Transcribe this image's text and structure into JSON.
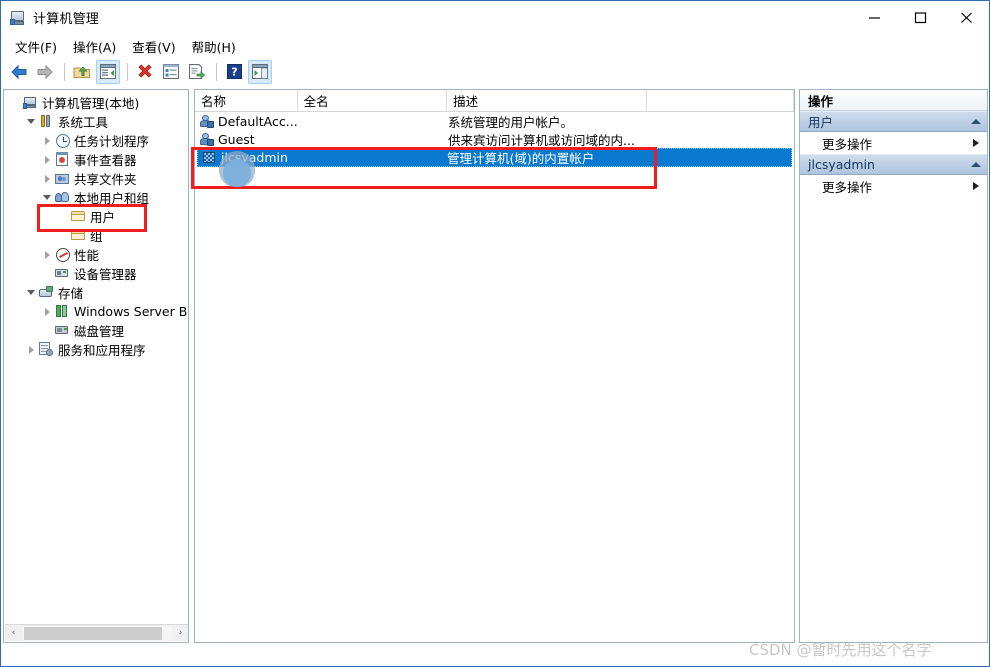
{
  "window": {
    "title": "计算机管理",
    "icon": "computer-management-icon",
    "minimize_label": "—",
    "maximize_label": "□",
    "close_label": "✕"
  },
  "menubar": {
    "items": [
      {
        "label": "文件(F)",
        "name": "menu-file"
      },
      {
        "label": "操作(A)",
        "name": "menu-action"
      },
      {
        "label": "查看(V)",
        "name": "menu-view"
      },
      {
        "label": "帮助(H)",
        "name": "menu-help"
      }
    ]
  },
  "toolbar": {
    "buttons": [
      {
        "name": "back-icon",
        "active": false
      },
      {
        "name": "forward-icon",
        "active": false
      },
      {
        "name": "up-folder-icon",
        "active": false
      },
      {
        "name": "show-hide-tree-icon",
        "active": true
      },
      {
        "name": "delete-icon",
        "active": false
      },
      {
        "name": "properties-icon",
        "active": false
      },
      {
        "name": "export-list-icon",
        "active": false
      },
      {
        "name": "help-icon",
        "active": false
      },
      {
        "name": "show-action-pane-icon",
        "active": true
      }
    ]
  },
  "tree": {
    "items": [
      {
        "label": "计算机管理(本地)",
        "indent": 0,
        "toggle": "none",
        "icon": "computer-icon",
        "name": "tree-item-computer-management"
      },
      {
        "label": "系统工具",
        "indent": 1,
        "toggle": "down",
        "icon": "tools-icon",
        "name": "tree-item-system-tools"
      },
      {
        "label": "任务计划程序",
        "indent": 2,
        "toggle": "right",
        "icon": "clock-icon",
        "name": "tree-item-task-scheduler"
      },
      {
        "label": "事件查看器",
        "indent": 2,
        "toggle": "right",
        "icon": "event-viewer-icon",
        "name": "tree-item-event-viewer"
      },
      {
        "label": "共享文件夹",
        "indent": 2,
        "toggle": "right",
        "icon": "shared-folders-icon",
        "name": "tree-item-shared-folders"
      },
      {
        "label": "本地用户和组",
        "indent": 2,
        "toggle": "down",
        "icon": "local-users-icon",
        "name": "tree-item-local-users-and-groups"
      },
      {
        "label": "用户",
        "indent": 3,
        "toggle": "none",
        "icon": "folder-icon",
        "name": "tree-item-users"
      },
      {
        "label": "组",
        "indent": 3,
        "toggle": "none",
        "icon": "folder-icon",
        "name": "tree-item-groups"
      },
      {
        "label": "性能",
        "indent": 2,
        "toggle": "right",
        "icon": "performance-icon",
        "name": "tree-item-performance"
      },
      {
        "label": "设备管理器",
        "indent": 2,
        "toggle": "none",
        "icon": "device-manager-icon",
        "name": "tree-item-device-manager"
      },
      {
        "label": "存储",
        "indent": 1,
        "toggle": "down",
        "icon": "storage-icon",
        "name": "tree-item-storage"
      },
      {
        "label": "Windows Server Back",
        "indent": 2,
        "toggle": "right",
        "icon": "backup-icon",
        "name": "tree-item-windows-server-backup"
      },
      {
        "label": "磁盘管理",
        "indent": 2,
        "toggle": "none",
        "icon": "disk-management-icon",
        "name": "tree-item-disk-management"
      },
      {
        "label": "服务和应用程序",
        "indent": 1,
        "toggle": "right",
        "icon": "services-icon",
        "name": "tree-item-services-and-applications"
      }
    ],
    "hscroll": {
      "left_arrow": "‹",
      "right_arrow": "›"
    }
  },
  "list": {
    "columns": [
      {
        "label": "名称",
        "name": "column-name"
      },
      {
        "label": "全名",
        "name": "column-full-name"
      },
      {
        "label": "描述",
        "name": "column-description"
      },
      {
        "label": "",
        "name": "column-extra"
      }
    ],
    "rows": [
      {
        "name": "DefaultAcc...",
        "full_name": "",
        "description": "系统管理的用户帐户。",
        "selected": false,
        "icon": "user-icon"
      },
      {
        "name": "Guest",
        "full_name": "",
        "description": "供来宾访问计算机或访问域的内...",
        "selected": false,
        "icon": "user-icon"
      },
      {
        "name": "jlcsyadmin",
        "full_name": "",
        "description": "管理计算机(域)的内置帐户",
        "selected": true,
        "icon": "admin-user-icon"
      }
    ]
  },
  "actions": {
    "title": "操作",
    "groups": [
      {
        "label": "用户",
        "name": "action-group-users",
        "items": [
          {
            "label": "更多操作",
            "name": "action-more-actions-users"
          }
        ]
      },
      {
        "label": "jlcsyadmin",
        "name": "action-group-jlcsyadmin",
        "items": [
          {
            "label": "更多操作",
            "name": "action-more-actions-jlcsyadmin"
          }
        ]
      }
    ]
  },
  "annotations": {
    "highlight_color": "#f01d1d",
    "boxes": [
      {
        "name": "annotation-users-tree-item"
      },
      {
        "name": "annotation-selected-user-row"
      }
    ]
  },
  "watermark": {
    "text": "CSDN @暂时先用这个名字"
  }
}
